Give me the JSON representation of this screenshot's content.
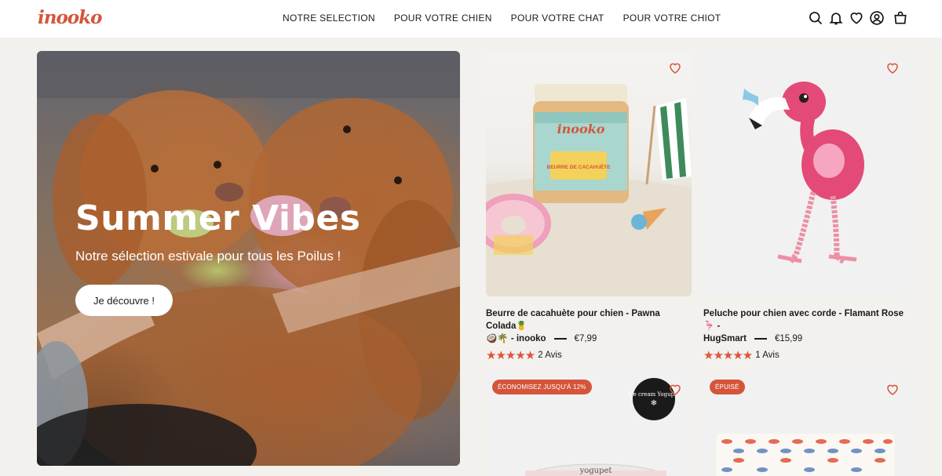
{
  "header": {
    "logo": "inooko",
    "nav": [
      "NOTRE SELECTION",
      "POUR VOTRE CHIEN",
      "POUR VOTRE CHAT",
      "POUR VOTRE CHIOT"
    ],
    "icons": [
      "search-icon",
      "bell-icon",
      "heart-icon",
      "account-icon",
      "cart-icon"
    ]
  },
  "hero": {
    "title": "Summer Vibes",
    "subtitle": "Notre sélection estivale pour tous les Poilus !",
    "cta": "Je découvre !"
  },
  "products": [
    {
      "title_line1": "Beurre de cacahuète pour chien - Pawna Colada🍍",
      "vendor": "🥥🌴 - inooko",
      "price": "€7,99",
      "stars": "★★★★★",
      "reviews": "2 Avis",
      "jar_brand": "inooko",
      "jar_label": "BEURRE DE CACAHUÈTE"
    },
    {
      "title_line1": "Peluche pour chien avec corde - Flamant Rose 🦩 -",
      "vendor": "HugSmart",
      "price": "€15,99",
      "stars": "★★★★★",
      "reviews": "1 Avis"
    }
  ],
  "bottom_cards": [
    {
      "badge": "ÉCONOMISEZ JUSQU'À 12%",
      "sticker": "Ice cream Yogupet",
      "product_label": "yogupet"
    },
    {
      "badge": "ÉPUISÉ"
    }
  ],
  "colors": {
    "accent": "#d5553b",
    "background": "#f3f1ee",
    "stars": "#e0533e"
  }
}
